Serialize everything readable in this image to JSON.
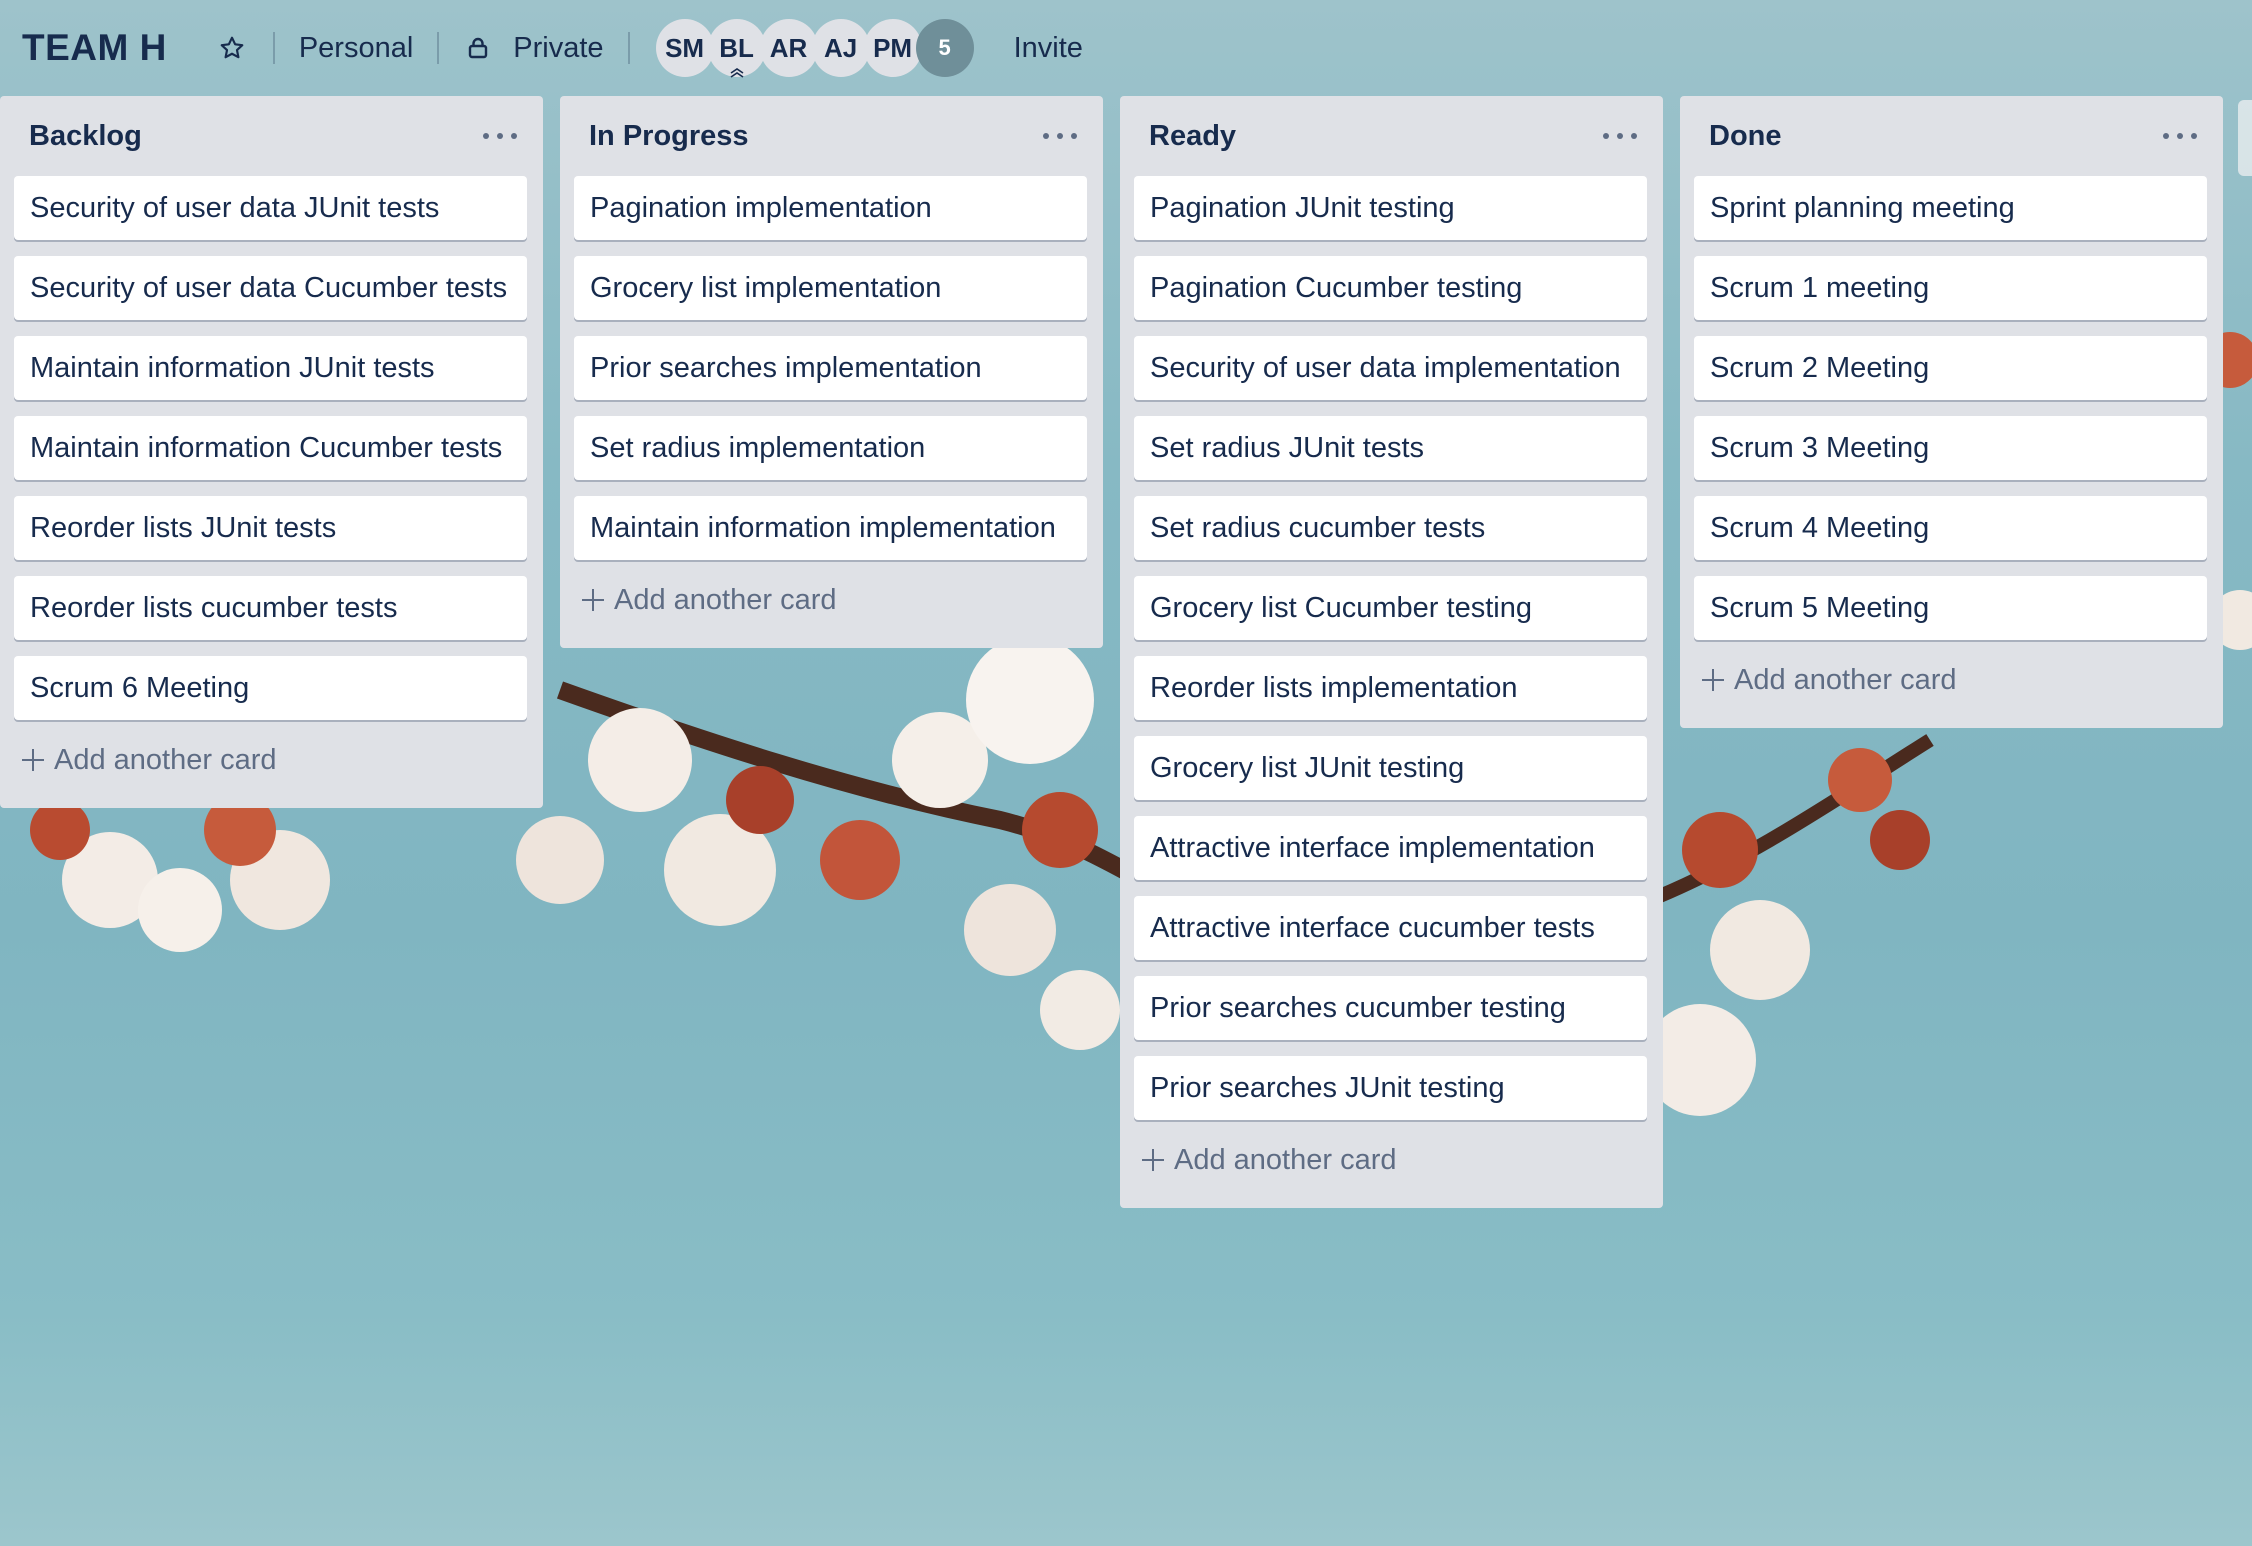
{
  "header": {
    "board_title": "TEAM H",
    "visibility_personal": "Personal",
    "visibility_private": "Private",
    "members": [
      "SM",
      "BL",
      "AR",
      "AJ",
      "PM"
    ],
    "member_overflow_count": "5",
    "invite_label": "Invite",
    "icons": [
      "star-icon",
      "lock-icon",
      "admin-chevron-icon"
    ]
  },
  "lists": [
    {
      "title": "Backlog",
      "cards": [
        "Security of user data JUnit tests",
        "Security of user data Cucumber tests",
        "Maintain information JUnit tests",
        "Maintain information Cucumber tests",
        "Reorder lists JUnit tests",
        "Reorder lists cucumber tests",
        "Scrum 6 Meeting"
      ],
      "add_label": "Add another card"
    },
    {
      "title": "In Progress",
      "cards": [
        "Pagination implementation",
        "Grocery list implementation",
        "Prior searches implementation",
        "Set radius implementation",
        "Maintain information implementation"
      ],
      "add_label": "Add another card"
    },
    {
      "title": "Ready",
      "cards": [
        "Pagination JUnit testing",
        "Pagination Cucumber testing",
        "Security of user data implementation",
        "Set radius JUnit tests",
        "Set radius cucumber tests",
        "Grocery list Cucumber testing",
        "Reorder lists implementation",
        "Grocery list JUnit testing",
        "Attractive interface implementation",
        "Attractive interface cucumber tests",
        "Prior searches cucumber testing",
        "Prior searches JUnit testing"
      ],
      "add_label": "Add another card"
    },
    {
      "title": "Done",
      "cards": [
        "Sprint planning meeting",
        "Scrum 1 meeting",
        "Scrum 2 Meeting",
        "Scrum 3 Meeting",
        "Scrum 4 Meeting",
        "Scrum 5 Meeting"
      ],
      "add_label": "Add another card"
    }
  ],
  "colors": {
    "list_bg": "#dfe1e6",
    "text": "#172b4d",
    "muted": "#5e6c84",
    "sky": "#87b9c4"
  }
}
